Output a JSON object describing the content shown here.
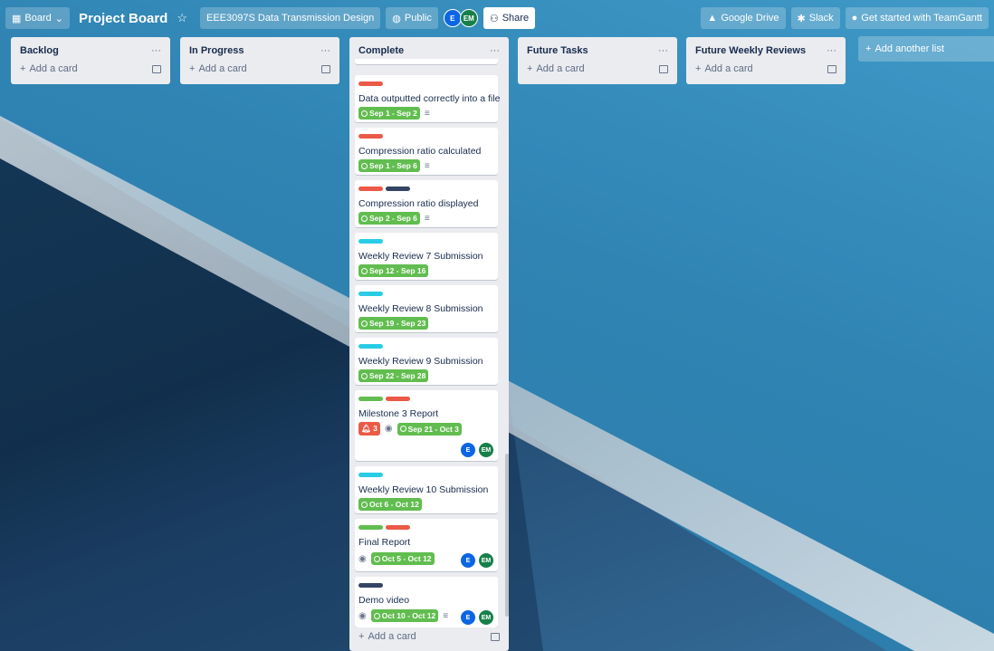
{
  "topbar": {
    "board_view": "Board",
    "board_title": "Project Board",
    "workspace": "EEE3097S Data Transmission Design",
    "visibility": "Public",
    "members": [
      "E",
      "EM"
    ],
    "share": "Share",
    "powerups": [
      "Google Drive",
      "Slack",
      "Get started with TeamGantt"
    ]
  },
  "lists": [
    {
      "title": "Backlog",
      "add": "Add a card"
    },
    {
      "title": "In Progress",
      "add": "Add a card"
    },
    {
      "title": "Complete",
      "add": "Add a card"
    },
    {
      "title": "Future Tasks",
      "add": "Add a card"
    },
    {
      "title": "Future Weekly Reviews",
      "add": "Add a card"
    }
  ],
  "add_list": "Add another list",
  "colors": {
    "green": "#61bd4f",
    "red": "#eb5a46",
    "cyan": "#29cce5",
    "navy": "#344563"
  },
  "cards": [
    {
      "title": "Data outputted correctly into a file",
      "labels": [
        "red"
      ],
      "due": "Sep 1 - Sep 2",
      "desc": true
    },
    {
      "title": "Compression ratio calculated",
      "labels": [
        "red"
      ],
      "due": "Sep 1 - Sep 6",
      "desc": true
    },
    {
      "title": "Compression ratio displayed",
      "labels": [
        "red",
        "navy"
      ],
      "due": "Sep 2 - Sep 6",
      "desc": true
    },
    {
      "title": "Weekly Review 7 Submission",
      "labels": [
        "cyan"
      ],
      "due": "Sep 12 - Sep 16"
    },
    {
      "title": "Weekly Review 8 Submission",
      "labels": [
        "cyan"
      ],
      "due": "Sep 19 - Sep 23"
    },
    {
      "title": "Weekly Review 9 Submission",
      "labels": [
        "cyan"
      ],
      "due": "Sep 22 - Sep 28"
    },
    {
      "title": "Milestone 3 Report",
      "labels": [
        "green",
        "red"
      ],
      "notifications": "3",
      "due": "Sep 21 - Oct 3",
      "members": [
        "E",
        "EM"
      ]
    },
    {
      "title": "Weekly Review 10 Submission",
      "labels": [
        "cyan"
      ],
      "due": "Oct 6 - Oct 12"
    },
    {
      "title": "Final Report",
      "labels": [
        "green",
        "red"
      ],
      "due": "Oct 5 - Oct 12",
      "members": [
        "E",
        "EM"
      ]
    },
    {
      "title": "Demo video",
      "labels": [
        "navy"
      ],
      "due": "Oct 10 - Oct 12",
      "desc": true,
      "members": [
        "E",
        "EM"
      ]
    }
  ]
}
